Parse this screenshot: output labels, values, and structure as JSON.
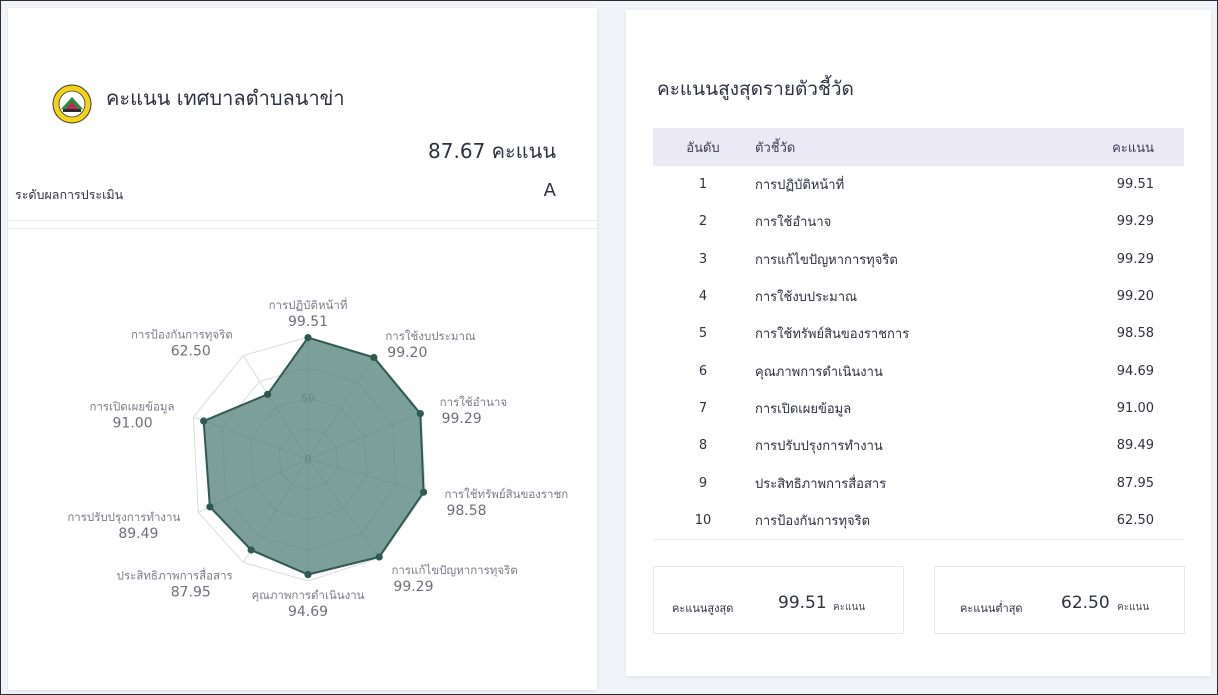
{
  "left_card": {
    "title": "คะแนน เทศบาลตำบลนาข่า",
    "total_score": "87.67 คะแนน",
    "level_label": "ระดับผลการประเมิน",
    "level_value": "A",
    "logo_icon": "municipality-seal-icon"
  },
  "right_card": {
    "title": "คะแนนสูงสุดรายตัวชี้วัด",
    "table": {
      "headers": [
        "อันดับ",
        "ตัวชี้วัด",
        "คะแนน"
      ],
      "rows": [
        [
          "1",
          "การปฏิบัติหน้าที่",
          "99.51"
        ],
        [
          "2",
          "การใช้อำนาจ",
          "99.29"
        ],
        [
          "3",
          "การแก้ไขปัญหาการทุจริต",
          "99.29"
        ],
        [
          "4",
          "การใช้งบประมาณ",
          "99.20"
        ],
        [
          "5",
          "การใช้ทรัพย์สินของราชการ",
          "98.58"
        ],
        [
          "6",
          "คุณภาพการดำเนินงาน",
          "94.69"
        ],
        [
          "7",
          "การเปิดเผยข้อมูล",
          "91.00"
        ],
        [
          "8",
          "การปรับปรุงการทำงาน",
          "89.49"
        ],
        [
          "9",
          "ประสิทธิภาพการสื่อสาร",
          "87.95"
        ],
        [
          "10",
          "การป้องกันการทุจริต",
          "62.50"
        ]
      ]
    },
    "max_box": {
      "label": "คะแนนสูงสุด",
      "value": "99.51",
      "unit": "คะแนน"
    },
    "min_box": {
      "label": "คะแนนต่ำสุด",
      "value": "62.50",
      "unit": "คะแนน"
    }
  },
  "chart_data": {
    "type": "radar",
    "categories": [
      "การปฏิบัติหน้าที่",
      "การใช้งบประมาณ",
      "การใช้อำนาจ",
      "การใช้ทรัพย์สินของราชก",
      "การแก้ไขปัญหาการทุจริต",
      "คุณภาพการดำเนินงาน",
      "ประสิทธิภาพการสื่อสาร",
      "การปรับปรุงการทำงาน",
      "การเปิดเผยข้อมูล",
      "การป้องกันการทุจริต"
    ],
    "values": [
      99.51,
      99.2,
      99.29,
      98.58,
      99.29,
      94.69,
      87.95,
      89.49,
      91.0,
      62.5
    ],
    "value_labels": [
      "99.51",
      "99.20",
      "99.29",
      "98.58",
      "99.29",
      "94.69",
      "87.95",
      "89.49",
      "91.00",
      "62.50"
    ],
    "rmax": 100,
    "scale_ticks": [
      "0",
      "50"
    ],
    "fill_color": "#4a7b71",
    "point_color": "#2f5a51",
    "grid_color": "#d9dbe0",
    "grid": true
  }
}
